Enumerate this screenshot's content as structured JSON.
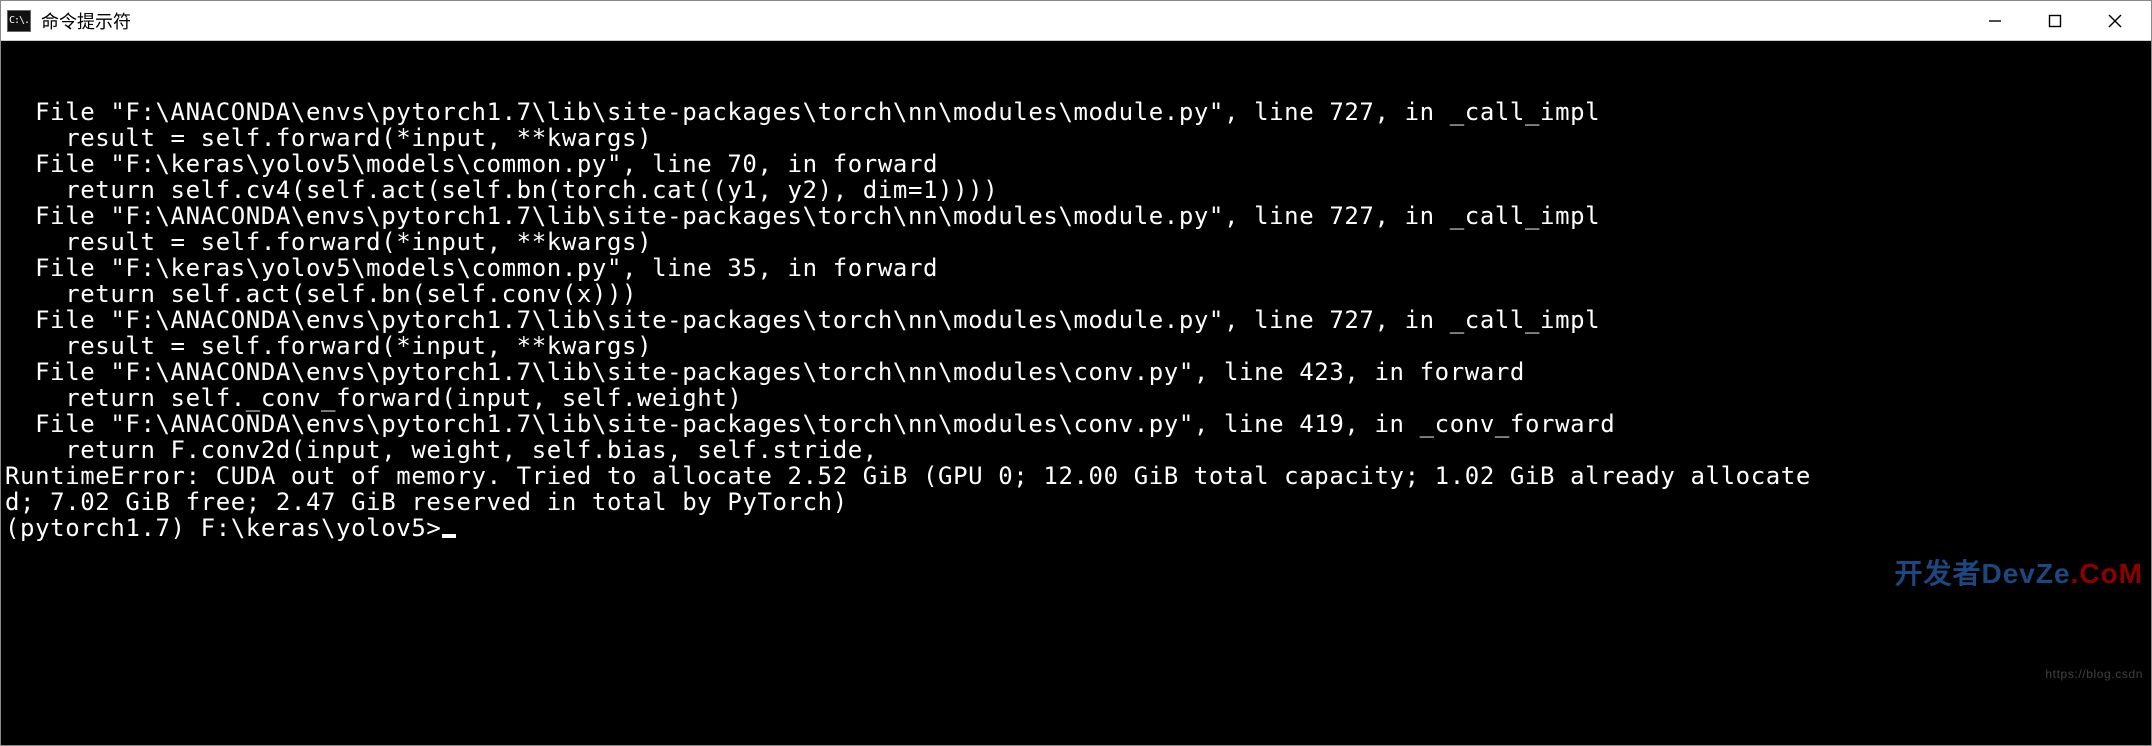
{
  "window": {
    "app_icon_text": "C:\\.",
    "title": "命令提示符",
    "controls": {
      "minimize_tip": "Minimize",
      "maximize_tip": "Maximize",
      "close_tip": "Close"
    }
  },
  "console": {
    "lines": [
      "  File \"F:\\ANACONDA\\envs\\pytorch1.7\\lib\\site-packages\\torch\\nn\\modules\\module.py\", line 727, in _call_impl",
      "    result = self.forward(*input, **kwargs)",
      "  File \"F:\\keras\\yolov5\\models\\common.py\", line 70, in forward",
      "    return self.cv4(self.act(self.bn(torch.cat((y1, y2), dim=1))))",
      "  File \"F:\\ANACONDA\\envs\\pytorch1.7\\lib\\site-packages\\torch\\nn\\modules\\module.py\", line 727, in _call_impl",
      "    result = self.forward(*input, **kwargs)",
      "  File \"F:\\keras\\yolov5\\models\\common.py\", line 35, in forward",
      "    return self.act(self.bn(self.conv(x)))",
      "  File \"F:\\ANACONDA\\envs\\pytorch1.7\\lib\\site-packages\\torch\\nn\\modules\\module.py\", line 727, in _call_impl",
      "    result = self.forward(*input, **kwargs)",
      "  File \"F:\\ANACONDA\\envs\\pytorch1.7\\lib\\site-packages\\torch\\nn\\modules\\conv.py\", line 423, in forward",
      "    return self._conv_forward(input, self.weight)",
      "  File \"F:\\ANACONDA\\envs\\pytorch1.7\\lib\\site-packages\\torch\\nn\\modules\\conv.py\", line 419, in _conv_forward",
      "    return F.conv2d(input, weight, self.bias, self.stride,",
      "RuntimeError: CUDA out of memory. Tried to allocate 2.52 GiB (GPU 0; 12.00 GiB total capacity; 1.02 GiB already allocate",
      "d; 7.02 GiB free; 2.47 GiB reserved in total by PyTorch)",
      "",
      "(pytorch1.7) F:\\keras\\yolov5>"
    ],
    "prompt_has_cursor": true
  },
  "watermark": {
    "prefix": "开发者",
    "brand_main": "DevZe",
    "brand_accent": ".CoM",
    "sub": "https://blog.csdn"
  }
}
